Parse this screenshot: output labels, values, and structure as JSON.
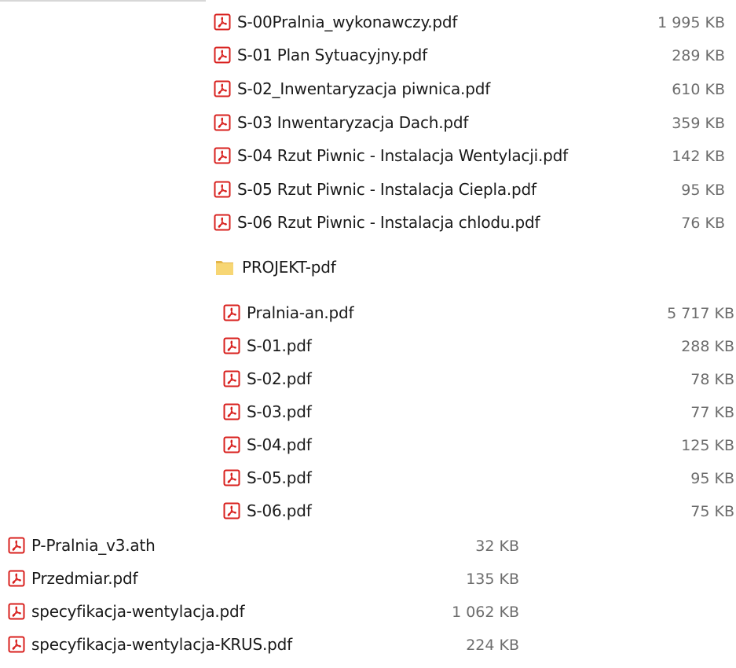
{
  "group_top": {
    "files": [
      {
        "name": "S-00Pralnia_wykonawczy.pdf",
        "size": "1 995 KB",
        "icon": "pdf-icon"
      },
      {
        "name": "S-01 Plan Sytuacyjny.pdf",
        "size": "289 KB",
        "icon": "pdf-icon"
      },
      {
        "name": "S-02_Inwentaryzacja piwnica.pdf",
        "size": "610 KB",
        "icon": "pdf-icon"
      },
      {
        "name": "S-03 Inwentaryzacja Dach.pdf",
        "size": "359 KB",
        "icon": "pdf-icon"
      },
      {
        "name": "S-04 Rzut Piwnic - Instalacja Wentylacji.pdf",
        "size": "142 KB",
        "icon": "pdf-icon"
      },
      {
        "name": "S-05 Rzut Piwnic - Instalacja Ciepla.pdf",
        "size": "95 KB",
        "icon": "pdf-icon"
      },
      {
        "name": "S-06 Rzut Piwnic - Instalacja chlodu.pdf",
        "size": "76 KB",
        "icon": "pdf-icon"
      }
    ]
  },
  "folder": {
    "name": "PROJEKT-pdf",
    "icon": "folder-icon"
  },
  "group_sub": {
    "files": [
      {
        "name": "Pralnia-an.pdf",
        "size": "5 717 KB",
        "icon": "pdf-icon"
      },
      {
        "name": "S-01.pdf",
        "size": "288 KB",
        "icon": "pdf-icon"
      },
      {
        "name": "S-02.pdf",
        "size": "78 KB",
        "icon": "pdf-icon"
      },
      {
        "name": "S-03.pdf",
        "size": "77 KB",
        "icon": "pdf-icon"
      },
      {
        "name": "S-04.pdf",
        "size": "125 KB",
        "icon": "pdf-icon"
      },
      {
        "name": "S-05.pdf",
        "size": "95 KB",
        "icon": "pdf-icon"
      },
      {
        "name": "S-06.pdf",
        "size": "75 KB",
        "icon": "pdf-icon"
      }
    ]
  },
  "group_bottom": {
    "files": [
      {
        "name": "P-Pralnia_v3.ath",
        "size": "32 KB",
        "icon": "pdf-icon"
      },
      {
        "name": "Przedmiar.pdf",
        "size": "135 KB",
        "icon": "pdf-icon"
      },
      {
        "name": "specyfikacja-wentylacja.pdf",
        "size": "1 062 KB",
        "icon": "pdf-icon"
      },
      {
        "name": "specyfikacja-wentylacja-KRUS.pdf",
        "size": "224 KB",
        "icon": "pdf-icon"
      }
    ]
  },
  "colors": {
    "pdf_red": "#d8201e",
    "folder_yellow": "#f7d674",
    "folder_yellow_dark": "#e4b64a",
    "size_gray": "#6d6d6d"
  }
}
